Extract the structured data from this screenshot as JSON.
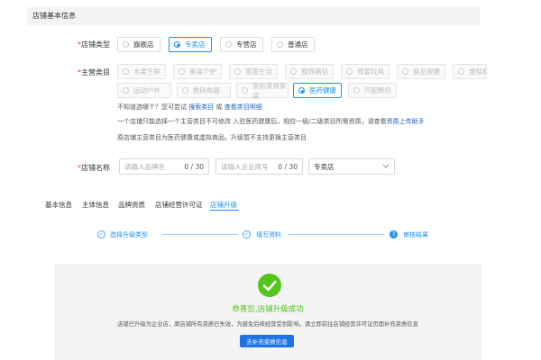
{
  "section_title": "店铺基本信息",
  "shop_type": {
    "label": "店铺类型",
    "options": [
      "旗舰店",
      "专卖店",
      "专营店",
      "普通店"
    ],
    "selected": "专卖店"
  },
  "category": {
    "label": "主营类目",
    "row1": [
      "水果生鲜",
      "美容个护",
      "家居生活",
      "服饰箱包",
      "母婴玩具",
      "食品保健",
      "虚拟商品"
    ],
    "row2": [
      "运动户外",
      "数码电器",
      "家纺家具家装",
      "医药健康",
      "汽配摩托"
    ],
    "selected": "医药健康",
    "hint1_prefix": "不知道选哪个？您可尝试",
    "hint1_link1": "搜索类目",
    "hint1_mid": "或",
    "hint1_link2": "查看类目明细",
    "hint2_text": "一个店铺只能选择一个主营类目不可修改 入驻医药健康后，相应一级/二级类目所需资质，请查看",
    "hint2_link": "资质上传助手",
    "hint3": "原店铺主营类目为医药健康或虚拟商品，升级暂不支持更换主营类目"
  },
  "shop_name": {
    "label": "店铺名称",
    "brand_placeholder": "请输入品牌名",
    "brand_count": "0 / 30",
    "company_placeholder": "请输入企业商号",
    "company_count": "0 / 30",
    "suffix_value": "专卖店"
  },
  "tabs": [
    "基本信息",
    "主体信息",
    "品牌资质",
    "店铺经营许可证",
    "店铺升级"
  ],
  "active_tab": "店铺升级",
  "steps": [
    {
      "label": "选择升级类型",
      "state": "done"
    },
    {
      "label": "填写资料",
      "state": "done"
    },
    {
      "label": "审核结果",
      "state": "current",
      "num": "3"
    }
  ],
  "result": {
    "title": "恭喜您,店铺升级成功",
    "description": "店铺已升级为企业店，原店铺所有资质已失效，为避免后续经营受到影响，请立即前往店铺经营许可证页面补充资质信息",
    "button_label": "去补充资质信息"
  },
  "colors": {
    "accent": "#1890ff",
    "success": "#52c41a",
    "required": "#e4393c",
    "link": "#1f5fbf"
  },
  "icons": {
    "check": "✓",
    "chevron": "chevron-down-icon",
    "success": "check-circle-icon"
  }
}
